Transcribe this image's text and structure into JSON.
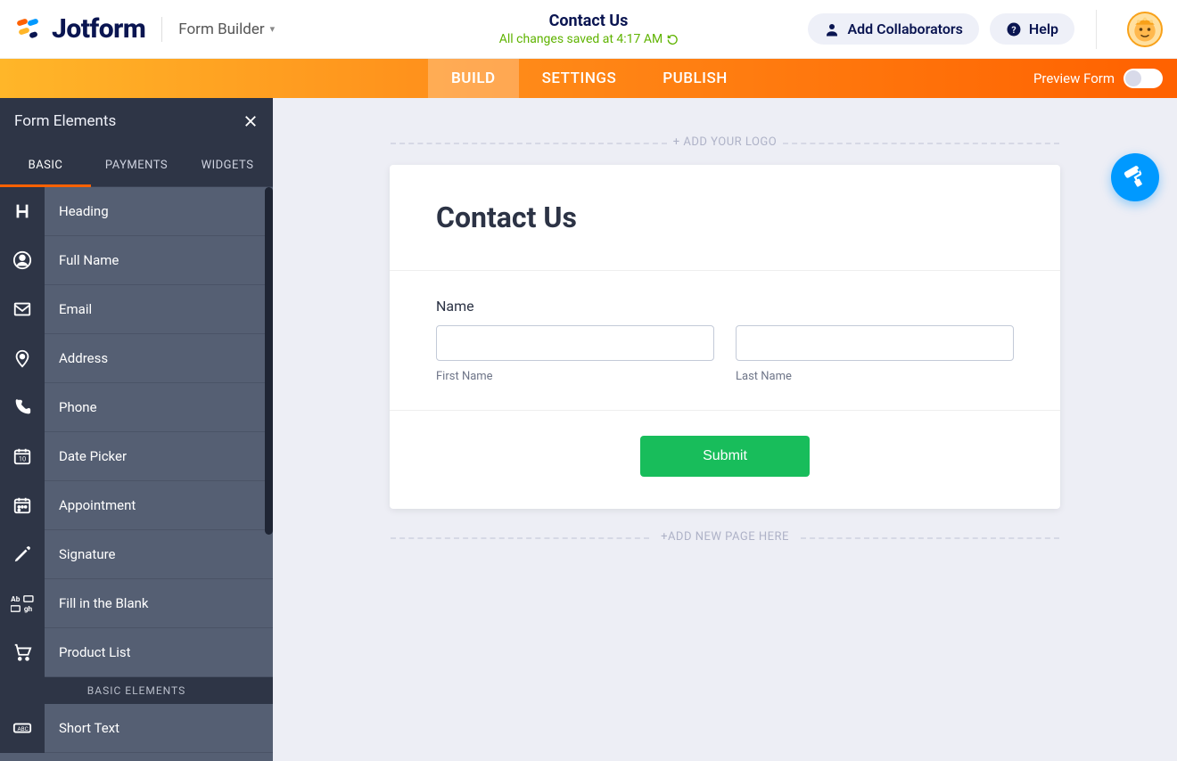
{
  "header": {
    "brand": "Jotform",
    "app_title": "Form Builder",
    "form_name": "Contact Us",
    "save_status": "All changes saved at 4:17 AM",
    "collaborators_label": "Add Collaborators",
    "help_label": "Help"
  },
  "nav": {
    "tabs": [
      {
        "label": "BUILD",
        "active": true
      },
      {
        "label": "SETTINGS",
        "active": false
      },
      {
        "label": "PUBLISH",
        "active": false
      }
    ],
    "preview_label": "Preview Form"
  },
  "sidebar": {
    "title": "Form Elements",
    "tabs": [
      {
        "label": "BASIC",
        "active": true
      },
      {
        "label": "PAYMENTS",
        "active": false
      },
      {
        "label": "WIDGETS",
        "active": false
      }
    ],
    "elements": [
      {
        "label": "Heading",
        "icon": "heading"
      },
      {
        "label": "Full Name",
        "icon": "user"
      },
      {
        "label": "Email",
        "icon": "mail"
      },
      {
        "label": "Address",
        "icon": "pin"
      },
      {
        "label": "Phone",
        "icon": "phone"
      },
      {
        "label": "Date Picker",
        "icon": "calendar"
      },
      {
        "label": "Appointment",
        "icon": "calendar-plus"
      },
      {
        "label": "Signature",
        "icon": "pen"
      },
      {
        "label": "Fill in the Blank",
        "icon": "blank"
      },
      {
        "label": "Product List",
        "icon": "cart"
      }
    ],
    "section_label": "BASIC ELEMENTS",
    "more_elements": [
      {
        "label": "Short Text",
        "icon": "shorttext"
      }
    ]
  },
  "canvas": {
    "logo_placeholder": "+ ADD YOUR LOGO",
    "form_title": "Contact Us",
    "name_field": {
      "label": "Name",
      "first_sublabel": "First Name",
      "last_sublabel": "Last Name"
    },
    "submit_label": "Submit",
    "page_placeholder": "+ADD NEW PAGE HERE"
  }
}
